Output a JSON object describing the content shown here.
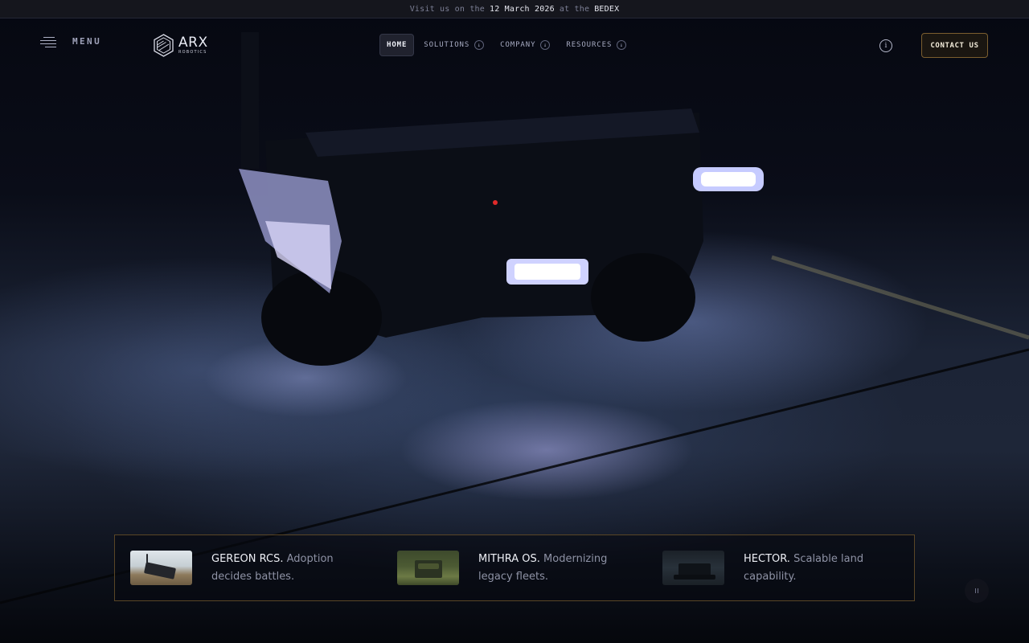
{
  "announcement": {
    "prefix": "Visit us on the",
    "date": "12 March 2026",
    "middle": "at the",
    "event": "BEDEX"
  },
  "header": {
    "menu_label": "MENU",
    "logo_text": "ARX",
    "logo_subtext": "ROBOTICS",
    "nav": [
      {
        "label": "HOME",
        "active": true
      },
      {
        "label": "SOLUTIONS",
        "has_dropdown": true
      },
      {
        "label": "COMPANY",
        "has_dropdown": true
      },
      {
        "label": "RESOURCES",
        "has_dropdown": true
      }
    ],
    "info_icon": "info-icon",
    "contact_label": "CONTACT US"
  },
  "products": [
    {
      "name": "GEREON RCS.",
      "tagline": "Adoption decides battles."
    },
    {
      "name": "MITHRA OS.",
      "tagline": "Modernizing legacy fleets."
    },
    {
      "name": "HECTOR.",
      "tagline": "Scalable land capability."
    }
  ],
  "controls": {
    "pause_icon": "pause-icon"
  },
  "colors": {
    "background": "#05070c",
    "accent_border": "#7b5e2f",
    "text_primary": "#eef0f6",
    "text_muted": "#8e92a5"
  }
}
